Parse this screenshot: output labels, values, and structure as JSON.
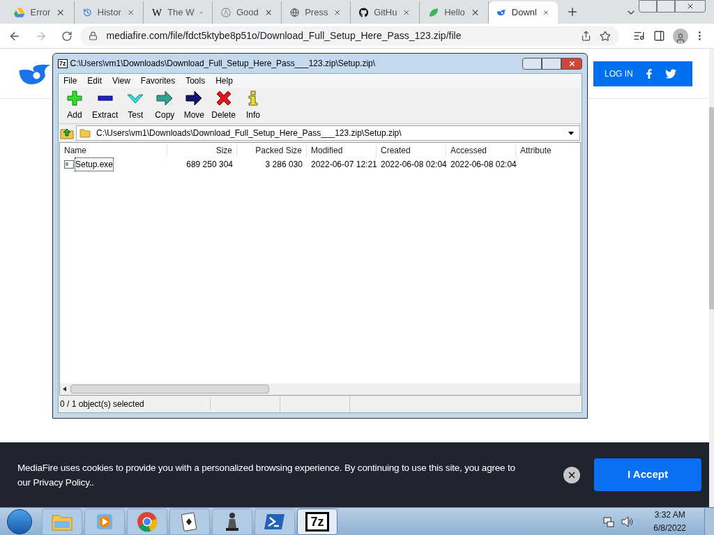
{
  "browser": {
    "tabs": [
      {
        "label": "Error",
        "kind": "drive",
        "selected": false
      },
      {
        "label": "Histor",
        "kind": "history",
        "selected": false
      },
      {
        "label": "The W",
        "kind": "letter",
        "icon_text": "W",
        "selected": false
      },
      {
        "label": "Good",
        "kind": "circle",
        "selected": false
      },
      {
        "label": "Press",
        "kind": "globe",
        "selected": false
      },
      {
        "label": "GitHu",
        "kind": "github",
        "selected": false
      },
      {
        "label": "Hello",
        "kind": "leaf",
        "selected": false
      },
      {
        "label": "Downl",
        "kind": "flame",
        "selected": true
      }
    ],
    "url": "mediafire.com/file/fdct5ktybe8p51o/Download_Full_Setup_Here_Pass_123.zip/file"
  },
  "page": {
    "login": "LOG IN",
    "cookie_text": "MediaFire uses cookies to provide you with a personalized browsing experience. By continuing to use this site, you agree to our Privacy Policy..",
    "accept": "I Accept"
  },
  "archiver": {
    "title_icon": "7z",
    "title": "C:\\Users\\vm1\\Downloads\\Download_Full_Setup_Here_Pass___123.zip\\Setup.zip\\",
    "menu": [
      "File",
      "Edit",
      "View",
      "Favorites",
      "Tools",
      "Help"
    ],
    "toolbar": [
      {
        "label": "Add",
        "kind": "add"
      },
      {
        "label": "Extract",
        "kind": "extract"
      },
      {
        "label": "Test",
        "kind": "test"
      },
      {
        "label": "Copy",
        "kind": "copy"
      },
      {
        "label": "Move",
        "kind": "move"
      },
      {
        "label": "Delete",
        "kind": "delete"
      },
      {
        "label": "Info",
        "kind": "info"
      }
    ],
    "path": "C:\\Users\\vm1\\Downloads\\Download_Full_Setup_Here_Pass___123.zip\\Setup.zip\\",
    "columns": [
      "Name",
      "Size",
      "Packed Size",
      "Modified",
      "Created",
      "Accessed",
      "Attribute"
    ],
    "rows": [
      {
        "cells": [
          "Setup.exe",
          "689 250 304",
          "3 286 030",
          "2022-06-07 12:21",
          "2022-06-08 02:04",
          "2022-06-08 02:04"
        ],
        "focused": true
      }
    ],
    "status": "0 / 1 object(s) selected"
  },
  "taskbar": {
    "apps": [
      {
        "kind": "explorer",
        "active": false
      },
      {
        "kind": "media",
        "active": false
      },
      {
        "kind": "chrome",
        "active": false
      },
      {
        "kind": "cards",
        "active": false
      },
      {
        "kind": "chess",
        "active": false
      },
      {
        "kind": "shell",
        "active": false
      },
      {
        "kind": "sevenzip",
        "label": "7z",
        "active": true
      }
    ],
    "time": "3:32 AM",
    "date": "6/8/2022"
  }
}
